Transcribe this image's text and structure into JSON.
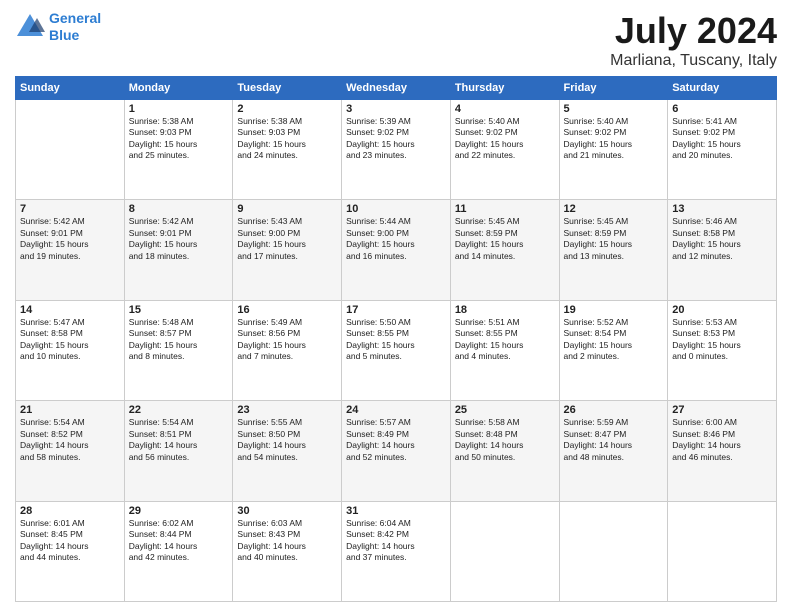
{
  "header": {
    "logo_line1": "General",
    "logo_line2": "Blue",
    "month": "July 2024",
    "location": "Marliana, Tuscany, Italy"
  },
  "weekdays": [
    "Sunday",
    "Monday",
    "Tuesday",
    "Wednesday",
    "Thursday",
    "Friday",
    "Saturday"
  ],
  "weeks": [
    [
      {
        "day": "",
        "info": ""
      },
      {
        "day": "1",
        "info": "Sunrise: 5:38 AM\nSunset: 9:03 PM\nDaylight: 15 hours\nand 25 minutes."
      },
      {
        "day": "2",
        "info": "Sunrise: 5:38 AM\nSunset: 9:03 PM\nDaylight: 15 hours\nand 24 minutes."
      },
      {
        "day": "3",
        "info": "Sunrise: 5:39 AM\nSunset: 9:02 PM\nDaylight: 15 hours\nand 23 minutes."
      },
      {
        "day": "4",
        "info": "Sunrise: 5:40 AM\nSunset: 9:02 PM\nDaylight: 15 hours\nand 22 minutes."
      },
      {
        "day": "5",
        "info": "Sunrise: 5:40 AM\nSunset: 9:02 PM\nDaylight: 15 hours\nand 21 minutes."
      },
      {
        "day": "6",
        "info": "Sunrise: 5:41 AM\nSunset: 9:02 PM\nDaylight: 15 hours\nand 20 minutes."
      }
    ],
    [
      {
        "day": "7",
        "info": "Sunrise: 5:42 AM\nSunset: 9:01 PM\nDaylight: 15 hours\nand 19 minutes."
      },
      {
        "day": "8",
        "info": "Sunrise: 5:42 AM\nSunset: 9:01 PM\nDaylight: 15 hours\nand 18 minutes."
      },
      {
        "day": "9",
        "info": "Sunrise: 5:43 AM\nSunset: 9:00 PM\nDaylight: 15 hours\nand 17 minutes."
      },
      {
        "day": "10",
        "info": "Sunrise: 5:44 AM\nSunset: 9:00 PM\nDaylight: 15 hours\nand 16 minutes."
      },
      {
        "day": "11",
        "info": "Sunrise: 5:45 AM\nSunset: 8:59 PM\nDaylight: 15 hours\nand 14 minutes."
      },
      {
        "day": "12",
        "info": "Sunrise: 5:45 AM\nSunset: 8:59 PM\nDaylight: 15 hours\nand 13 minutes."
      },
      {
        "day": "13",
        "info": "Sunrise: 5:46 AM\nSunset: 8:58 PM\nDaylight: 15 hours\nand 12 minutes."
      }
    ],
    [
      {
        "day": "14",
        "info": "Sunrise: 5:47 AM\nSunset: 8:58 PM\nDaylight: 15 hours\nand 10 minutes."
      },
      {
        "day": "15",
        "info": "Sunrise: 5:48 AM\nSunset: 8:57 PM\nDaylight: 15 hours\nand 8 minutes."
      },
      {
        "day": "16",
        "info": "Sunrise: 5:49 AM\nSunset: 8:56 PM\nDaylight: 15 hours\nand 7 minutes."
      },
      {
        "day": "17",
        "info": "Sunrise: 5:50 AM\nSunset: 8:55 PM\nDaylight: 15 hours\nand 5 minutes."
      },
      {
        "day": "18",
        "info": "Sunrise: 5:51 AM\nSunset: 8:55 PM\nDaylight: 15 hours\nand 4 minutes."
      },
      {
        "day": "19",
        "info": "Sunrise: 5:52 AM\nSunset: 8:54 PM\nDaylight: 15 hours\nand 2 minutes."
      },
      {
        "day": "20",
        "info": "Sunrise: 5:53 AM\nSunset: 8:53 PM\nDaylight: 15 hours\nand 0 minutes."
      }
    ],
    [
      {
        "day": "21",
        "info": "Sunrise: 5:54 AM\nSunset: 8:52 PM\nDaylight: 14 hours\nand 58 minutes."
      },
      {
        "day": "22",
        "info": "Sunrise: 5:54 AM\nSunset: 8:51 PM\nDaylight: 14 hours\nand 56 minutes."
      },
      {
        "day": "23",
        "info": "Sunrise: 5:55 AM\nSunset: 8:50 PM\nDaylight: 14 hours\nand 54 minutes."
      },
      {
        "day": "24",
        "info": "Sunrise: 5:57 AM\nSunset: 8:49 PM\nDaylight: 14 hours\nand 52 minutes."
      },
      {
        "day": "25",
        "info": "Sunrise: 5:58 AM\nSunset: 8:48 PM\nDaylight: 14 hours\nand 50 minutes."
      },
      {
        "day": "26",
        "info": "Sunrise: 5:59 AM\nSunset: 8:47 PM\nDaylight: 14 hours\nand 48 minutes."
      },
      {
        "day": "27",
        "info": "Sunrise: 6:00 AM\nSunset: 8:46 PM\nDaylight: 14 hours\nand 46 minutes."
      }
    ],
    [
      {
        "day": "28",
        "info": "Sunrise: 6:01 AM\nSunset: 8:45 PM\nDaylight: 14 hours\nand 44 minutes."
      },
      {
        "day": "29",
        "info": "Sunrise: 6:02 AM\nSunset: 8:44 PM\nDaylight: 14 hours\nand 42 minutes."
      },
      {
        "day": "30",
        "info": "Sunrise: 6:03 AM\nSunset: 8:43 PM\nDaylight: 14 hours\nand 40 minutes."
      },
      {
        "day": "31",
        "info": "Sunrise: 6:04 AM\nSunset: 8:42 PM\nDaylight: 14 hours\nand 37 minutes."
      },
      {
        "day": "",
        "info": ""
      },
      {
        "day": "",
        "info": ""
      },
      {
        "day": "",
        "info": ""
      }
    ]
  ]
}
